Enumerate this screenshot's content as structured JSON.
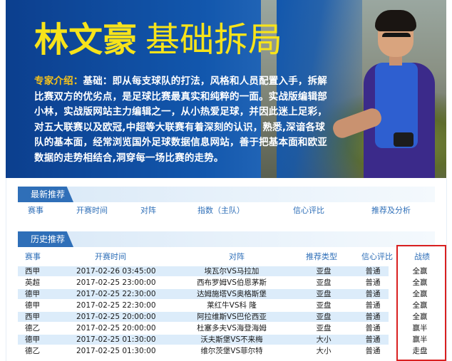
{
  "banner": {
    "name": "林文豪",
    "subtitle": "基础拆局",
    "intro_label": "专家介绍：",
    "intro_text": "基础：即从每支球队的打法，风格和人员配置入手，拆解比赛双方的优劣点，是足球比赛最真实和纯粹的一面。实战版编辑部小林，实战版网站主力编辑之一，从小热爱足球，并因此迷上足彩，对五大联赛以及欧冠,中超等大联赛有着深刻的认识，熟悉,深谙各球队的基本面，经常浏览国外足球数据信息网站，善于把基本面和欧亚数据的走势相结合,洞穿每一场比赛的走势。"
  },
  "latest": {
    "tab_label": "最新推荐",
    "headers": [
      "赛事",
      "开赛时间",
      "对阵",
      "指数（主队）",
      "信心评比",
      "推荐及分析"
    ]
  },
  "history": {
    "tab_label": "历史推荐",
    "headers": [
      "赛事",
      "开赛时间",
      "对阵",
      "推荐类型",
      "信心评比",
      "战绩"
    ],
    "rows": [
      {
        "league": "西甲",
        "time": "2017-02-26 03:45:00",
        "match": "埃瓦尔VS马拉加",
        "type": "亚盘",
        "confidence": "普通",
        "result": "全赢"
      },
      {
        "league": "英超",
        "time": "2017-02-25 23:00:00",
        "match": "西布罗姆VS伯恩茅斯",
        "type": "亚盘",
        "confidence": "普通",
        "result": "全赢"
      },
      {
        "league": "德甲",
        "time": "2017-02-25 22:30:00",
        "match": "达姆施塔VS奥格斯堡",
        "type": "亚盘",
        "confidence": "普通",
        "result": "全赢"
      },
      {
        "league": "德甲",
        "time": "2017-02-25 22:30:00",
        "match": "莱红牛VS科 隆",
        "type": "亚盘",
        "confidence": "普通",
        "result": "全赢"
      },
      {
        "league": "西甲",
        "time": "2017-02-25 20:00:00",
        "match": "阿拉维斯VS巴伦西亚",
        "type": "亚盘",
        "confidence": "普通",
        "result": "全赢"
      },
      {
        "league": "德乙",
        "time": "2017-02-25 20:00:00",
        "match": "杜塞多夫VS海登海姆",
        "type": "亚盘",
        "confidence": "普通",
        "result": "赢半"
      },
      {
        "league": "德甲",
        "time": "2017-02-25 01:30:00",
        "match": "沃夫斯堡VS不来梅",
        "type": "大小",
        "confidence": "普通",
        "result": "赢半"
      },
      {
        "league": "德乙",
        "time": "2017-02-25 01:30:00",
        "match": "维尔茨堡VS菲尔特",
        "type": "大小",
        "confidence": "普通",
        "result": "走盘"
      }
    ]
  },
  "colors": {
    "title_yellow": "#f7e31a",
    "tab_blue": "#2f6fb8",
    "header_text": "#2f6fb8",
    "row_stripe": "#dcecfa",
    "highlight_red": "#d92020"
  }
}
